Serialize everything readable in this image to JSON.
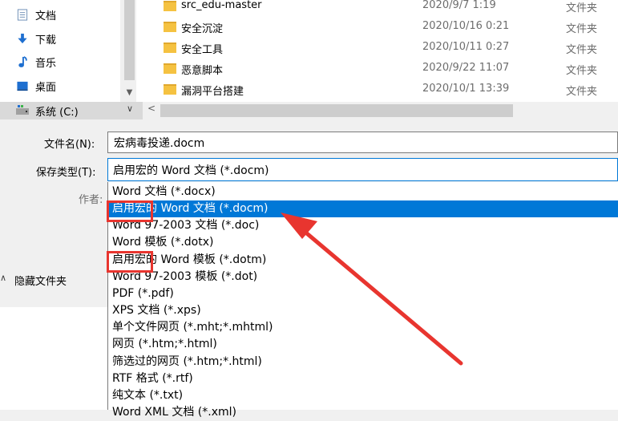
{
  "nav": {
    "items": [
      {
        "label": "文档",
        "icon": "document-icon"
      },
      {
        "label": "下载",
        "icon": "download-icon"
      },
      {
        "label": "音乐",
        "icon": "music-icon"
      },
      {
        "label": "桌面",
        "icon": "desktop-icon"
      }
    ],
    "drive": {
      "label": "系统 (C:)",
      "icon": "drive-icon"
    }
  },
  "files": [
    {
      "name": "src_edu-master",
      "date": "2020/9/7 1:19",
      "type": "文件夹"
    },
    {
      "name": "安全沉淀",
      "date": "2020/10/16 0:21",
      "type": "文件夹"
    },
    {
      "name": "安全工具",
      "date": "2020/10/11 0:27",
      "type": "文件夹"
    },
    {
      "name": "恶意脚本",
      "date": "2020/9/22 11:07",
      "type": "文件夹"
    },
    {
      "name": "漏洞平台搭建",
      "date": "2020/10/1 13:39",
      "type": "文件夹"
    }
  ],
  "form": {
    "filename_label": "文件名(N):",
    "filename_value": "宏病毒投递.docm",
    "savetype_label": "保存类型(T):",
    "savetype_value": "启用宏的 Word 文档 (*.docm)",
    "author_label": "作者:",
    "hide_folders_label": "隐藏文件夹"
  },
  "dropdown": {
    "selected_index": 1,
    "options": [
      "Word 文档 (*.docx)",
      "启用宏的 Word 文档 (*.docm)",
      "Word 97-2003 文档 (*.doc)",
      "Word 模板 (*.dotx)",
      "启用宏的 Word 模板 (*.dotm)",
      "Word 97-2003 模板 (*.dot)",
      "PDF (*.pdf)",
      "XPS 文档 (*.xps)",
      "单个文件网页 (*.mht;*.mhtml)",
      "网页 (*.htm;*.html)",
      "筛选过的网页 (*.htm;*.html)",
      "RTF 格式 (*.rtf)",
      "纯文本 (*.txt)",
      "Word XML 文档 (*.xml)"
    ]
  },
  "colors": {
    "selection": "#0078d7",
    "annotation": "#e8352f",
    "folder": "#f5c241"
  }
}
